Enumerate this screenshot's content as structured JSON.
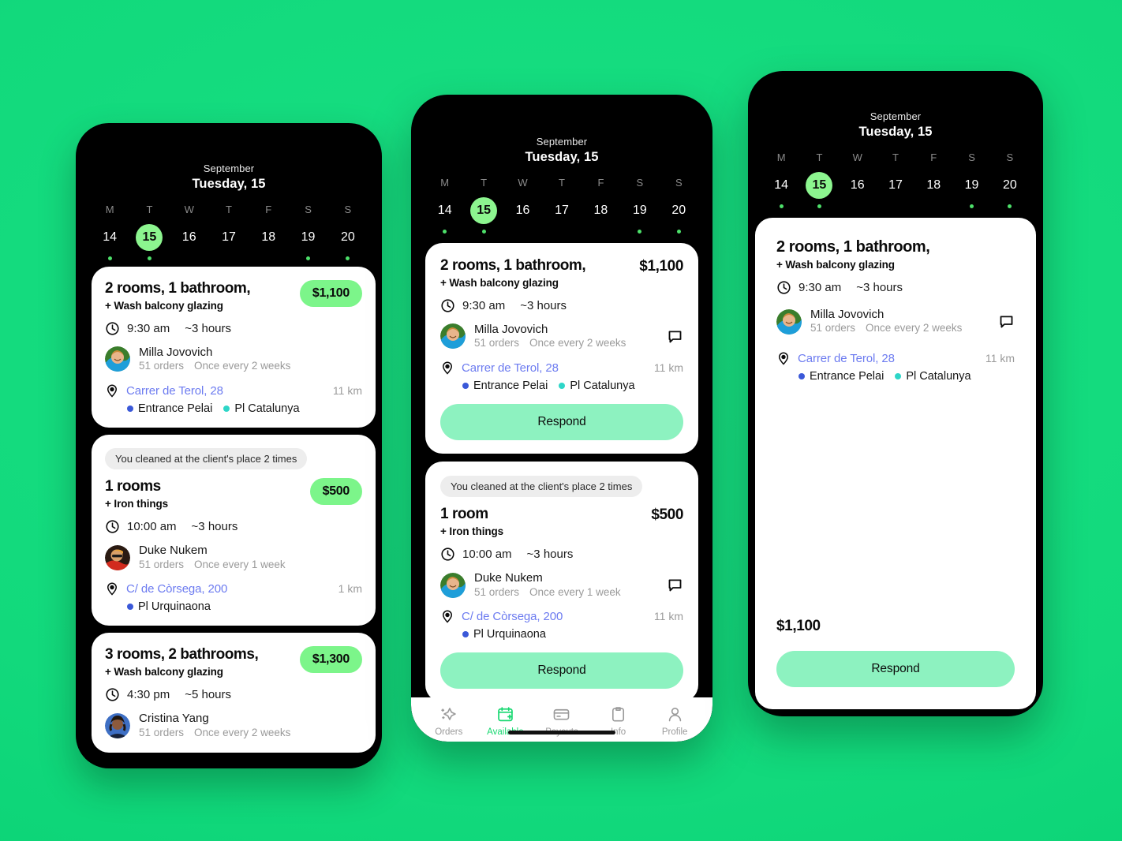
{
  "background_color": "#12D97C",
  "accent_green": "#8CF58F",
  "price_pill_color": "#7CF58A",
  "respond_button_color": "#8DF2C0",
  "link_color": "#6C7BF0",
  "calendar": {
    "month": "September",
    "selected_day_label": "Tuesday, 15",
    "weekday_initials": [
      "M",
      "T",
      "W",
      "T",
      "F",
      "S",
      "S"
    ],
    "dates": [
      "14",
      "15",
      "16",
      "17",
      "18",
      "19",
      "20"
    ],
    "selected_index": 1,
    "dots": [
      true,
      true,
      false,
      false,
      false,
      true,
      true
    ]
  },
  "metro_colors": {
    "blue": "#3A58D8",
    "cyan": "#2ED6C8"
  },
  "orders": {
    "order1": {
      "title": "2 rooms, 1 bathroom,",
      "subtitle": "+ Wash balcony glazing",
      "price": "$1,100",
      "time": "9:30 am",
      "duration": "~3 hours",
      "client_name": "Milla Jovovich",
      "client_orders": "51 orders",
      "client_frequency": "Once every 2 weeks",
      "address": "Carrer de Terol, 28",
      "distance": "11 km",
      "metro": [
        {
          "label": "Entrance Pelai",
          "color": "#3A58D8"
        },
        {
          "label": "Pl Catalunya",
          "color": "#2ED6C8"
        }
      ],
      "respond_label": "Respond"
    },
    "order2": {
      "visits_badge": "You cleaned at the client's place 2 times",
      "title_phone1": "1 rooms",
      "title_phone2": "1 room",
      "subtitle": "+ Iron things",
      "price": "$500",
      "time": "10:00 am",
      "duration": "~3 hours",
      "client_name": "Duke Nukem",
      "client_orders": "51 orders",
      "client_frequency": "Once every 1 week",
      "address": "C/ de Còrsega, 200",
      "distance_phone1": "1 km",
      "distance_phone2": "11 km",
      "metro": [
        {
          "label": "Pl Urquinaona",
          "color": "#3A58D8"
        }
      ],
      "respond_label": "Respond"
    },
    "order3": {
      "title": "3 rooms, 2 bathrooms,",
      "subtitle": "+ Wash balcony glazing",
      "price": "$1,300",
      "time": "4:30 pm",
      "duration": "~5 hours",
      "client_name": "Cristina Yang",
      "client_orders": "51 orders",
      "client_frequency": "Once every 2 weeks"
    }
  },
  "detail": {
    "title": "2 rooms, 1 bathroom,",
    "subtitle": "+ Wash balcony glazing",
    "time": "9:30 am",
    "duration": "~3 hours",
    "client_name": "Milla Jovovich",
    "client_orders": "51 orders",
    "client_frequency": "Once every 2 weeks",
    "address": "Carrer de Terol, 28",
    "distance": "11 km",
    "metro": [
      {
        "label": "Entrance Pelai",
        "color": "#3A58D8"
      },
      {
        "label": "Pl Catalunya",
        "color": "#2ED6C8"
      }
    ],
    "price": "$1,100",
    "respond_label": "Respond"
  },
  "tabbar": {
    "items": [
      {
        "label": "Orders",
        "icon": "sparkle-icon",
        "active": false
      },
      {
        "label": "Available",
        "icon": "calendar-plus-icon",
        "active": true
      },
      {
        "label": "Payouts",
        "icon": "card-icon",
        "active": false
      },
      {
        "label": "Info",
        "icon": "clipboard-icon",
        "active": false
      },
      {
        "label": "Profile",
        "icon": "person-icon",
        "active": false
      }
    ]
  }
}
